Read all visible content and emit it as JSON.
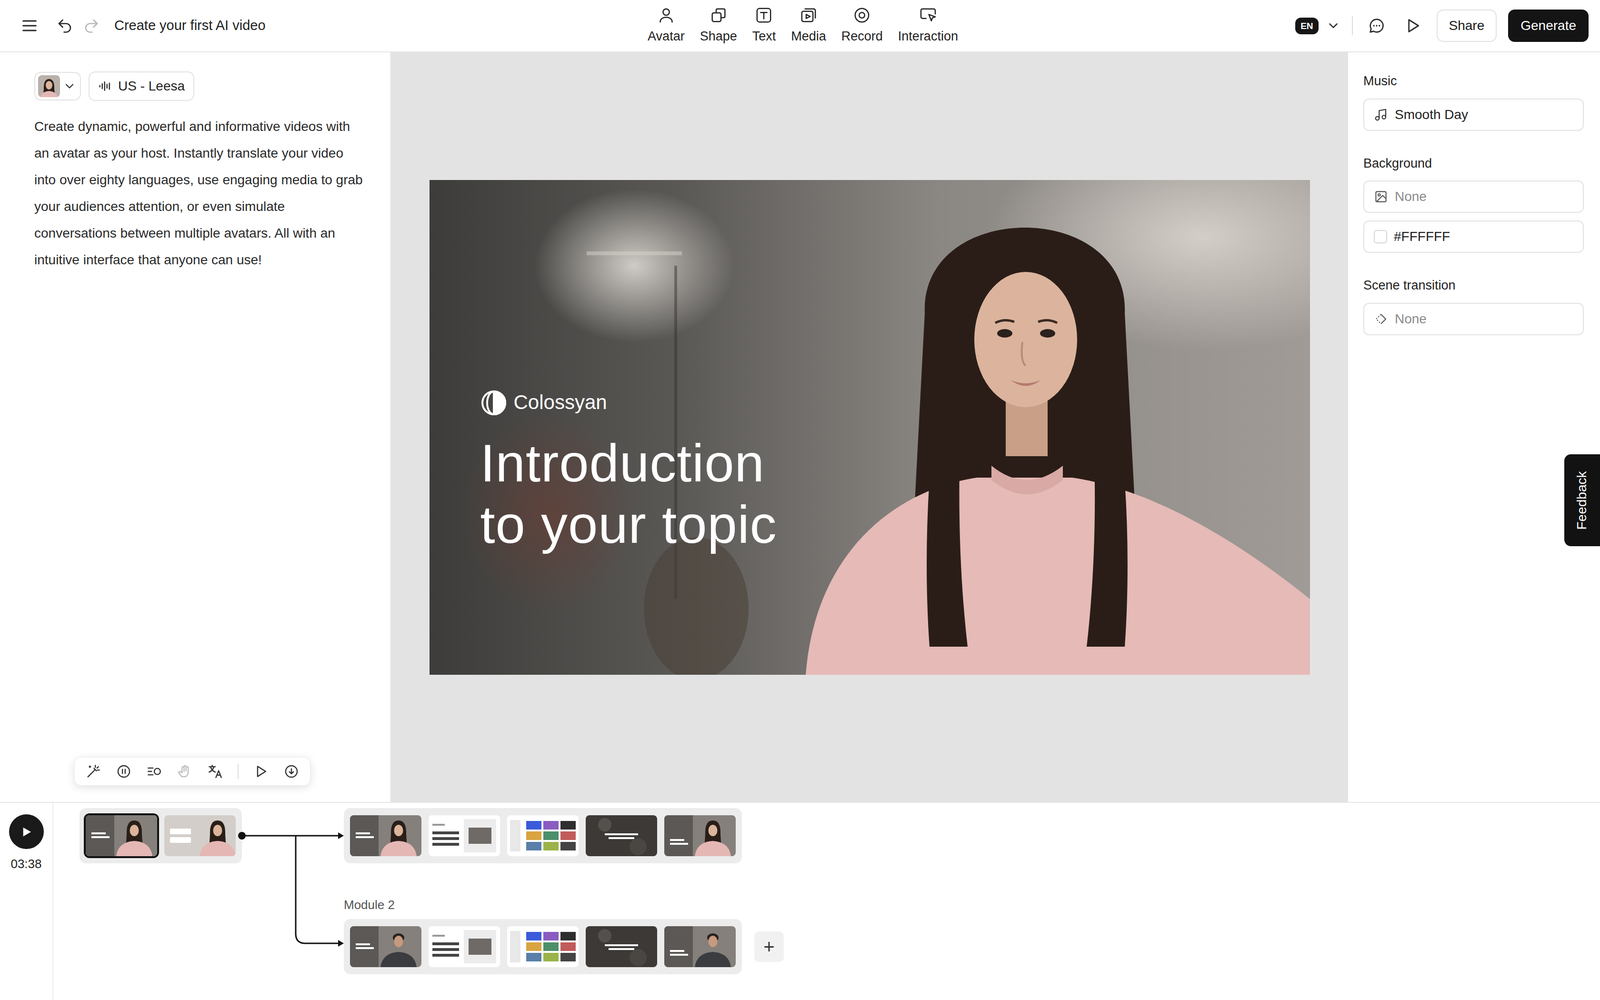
{
  "window": {
    "title": "Create your first AI video"
  },
  "history": {
    "undo_disabled": false,
    "redo_disabled": true
  },
  "tools": [
    "Avatar",
    "Shape",
    "Text",
    "Media",
    "Record",
    "Interaction"
  ],
  "language": "EN",
  "buttons": {
    "share": "Share",
    "generate": "Generate"
  },
  "script": {
    "voice": "US - Leesa",
    "text": "Create dynamic, powerful and informative videos with an avatar as your host. Instantly translate your video into over eighty languages, use engaging media to grab your audiences attention, or even simulate conversations between multiple avatars. All with an intuitive interface that anyone can use!"
  },
  "script_tools": [
    {
      "disabled": false
    },
    {
      "disabled": false
    },
    {
      "disabled": false
    },
    {
      "disabled": true
    },
    {
      "disabled": false
    },
    {
      "disabled": false
    },
    {
      "disabled": false
    }
  ],
  "slide": {
    "logo": "Colossyan",
    "title_lines": [
      "Introduction",
      "to your topic"
    ]
  },
  "properties": {
    "music": {
      "label": "Music",
      "value": "Smooth Day",
      "empty": false
    },
    "background": {
      "label": "Background",
      "image": "None",
      "image_empty": true,
      "color": "#FFFFFF"
    },
    "transition": {
      "label": "Scene transition",
      "value": "None",
      "empty": true
    }
  },
  "feedback": "Feedback",
  "timeline": {
    "duration": "03:38",
    "main": [
      {
        "kind": "avatar",
        "selected": true
      },
      {
        "kind": "cards",
        "selected": false
      }
    ],
    "branches": [
      {
        "scenes": [
          {
            "kind": "avatar",
            "selected": false
          },
          {
            "kind": "agenda",
            "selected": false
          },
          {
            "kind": "gallery",
            "selected": false
          },
          {
            "kind": "quote",
            "selected": false
          },
          {
            "kind": "outro",
            "selected": false
          }
        ]
      },
      {
        "label": "Module 2",
        "scenes": [
          {
            "kind": "avatar",
            "selected": false
          },
          {
            "kind": "agenda",
            "selected": false
          },
          {
            "kind": "gallery",
            "selected": false
          },
          {
            "kind": "quote",
            "selected": false
          },
          {
            "kind": "outro",
            "selected": false
          }
        ]
      }
    ],
    "add": "+"
  }
}
